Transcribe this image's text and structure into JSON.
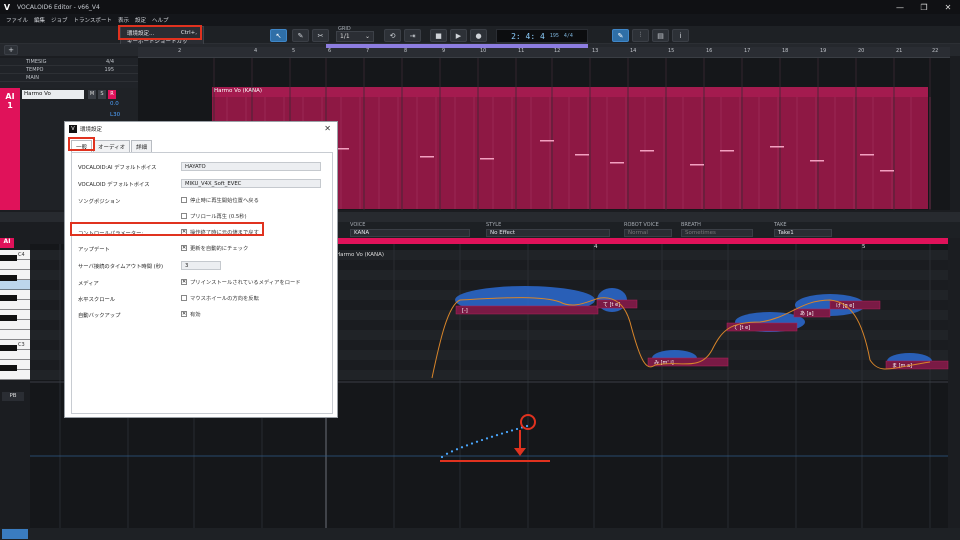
{
  "window": {
    "title": "VOCALOID6 Editor - v66_V4",
    "logo": "V",
    "controls": [
      "—",
      "❐",
      "✕"
    ]
  },
  "menu": [
    "ファイル",
    "編集",
    "ジョブ",
    "トランスポート",
    "表示",
    "設定",
    "ヘルプ"
  ],
  "settings_menu": {
    "items": [
      {
        "label": "環境設定...",
        "shortcut": "Ctrl+,"
      },
      {
        "label": "キーボードショートカット..."
      }
    ]
  },
  "toolbar": {
    "grid_label": "GRID",
    "grid_value": "1/1",
    "position": "2: 4: 4",
    "tempo": "195",
    "timesig": "4/4"
  },
  "ruler": {
    "bars": [
      "2",
      "4",
      "5",
      "6",
      "7",
      "8",
      "9",
      "10",
      "11",
      "12",
      "13",
      "14",
      "15",
      "16",
      "17",
      "18",
      "19",
      "20",
      "21",
      "22"
    ]
  },
  "track_header": {
    "rows": [
      {
        "label": "TIMESIG",
        "value": "4/4"
      },
      {
        "label": "TEMPO",
        "value": "195"
      },
      {
        "label": "MAIN",
        "value": ""
      }
    ]
  },
  "track": {
    "tag": "AI",
    "number": "1",
    "name": "Harmo Vo",
    "vol": "0.0",
    "pan": "L30",
    "buttons": [
      "M",
      "S",
      "R"
    ]
  },
  "arrange": {
    "part_label": "Harmo Vo (KANA)"
  },
  "properties": {
    "voice": {
      "label": "VOICE",
      "value": "KANA"
    },
    "style": {
      "label": "STYLE",
      "value": "No Effect"
    },
    "robot_voice": {
      "label": "ROBOT VOICE",
      "value": "Normal"
    },
    "breath": {
      "label": "BREATH",
      "value": "Sometimes"
    },
    "take": {
      "label": "TAKE",
      "value": "Take1"
    }
  },
  "editor": {
    "part_label": "Harmo Vo (KANA)",
    "bar_label": "4",
    "bar5": "5",
    "notes": [
      "[-]",
      "て [t e]",
      "て [t e]",
      "み [m' i]",
      "あ [a]",
      "げ [g e]",
      "ま [m a]"
    ],
    "key_labels": [
      "C4",
      "C3"
    ],
    "lane": "PB"
  },
  "dialog": {
    "title": "環境設定",
    "tabs": [
      "一般",
      "オーディオ",
      "詳細"
    ],
    "rows": [
      {
        "label": "VOCALOID:AI デフォルトボイス",
        "value": "HAYATO"
      },
      {
        "label": "VOCALOID デフォルトボイス",
        "value": "MIKU_V4X_Soft_EVEC"
      },
      {
        "label": "ソングポジション",
        "check": "停止時に再生開始位置へ戻る",
        "checked": false
      },
      {
        "label": "",
        "check": "プリロール再生 (0.5秒)",
        "checked": false
      },
      {
        "label": "コントロールパラメーター:",
        "check": "操作終了時に元の値まで戻す",
        "checked": true
      },
      {
        "label": "アップデート",
        "check": "更新を自動的にチェック",
        "checked": true
      },
      {
        "label": "サーバ接続のタイムアウト時間 (秒)",
        "value": "3"
      },
      {
        "label": "メディア",
        "check": "プリインストールされているメディアをロード",
        "checked": true
      },
      {
        "label": "水平スクロール",
        "check": "マウスホイールの方向を反転",
        "checked": false
      },
      {
        "label": "自動バックアップ",
        "check": "有効",
        "checked": true
      }
    ]
  },
  "colors": {
    "accent_pink": "#e0125a",
    "highlight_red": "#e0321f",
    "wave_blue": "#2a66c8",
    "pitch_orange": "#d8852a"
  }
}
